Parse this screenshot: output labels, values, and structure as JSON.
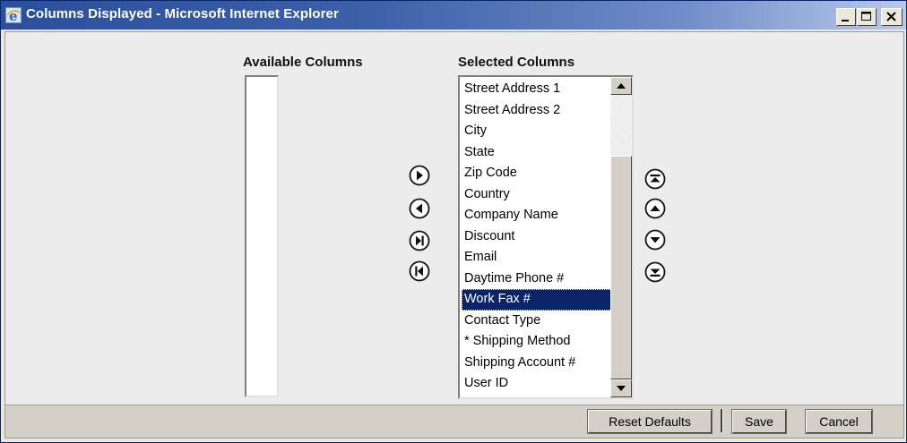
{
  "window": {
    "title": "Columns Displayed - Microsoft Internet Explorer",
    "controls": [
      "minimize",
      "maximize",
      "close"
    ]
  },
  "available": {
    "heading": "Available Columns",
    "items": []
  },
  "selected": {
    "heading": "Selected Columns",
    "items": [
      "Street Address 1",
      "Street Address 2",
      "City",
      "State",
      "Zip Code",
      "Country",
      "Company Name",
      "Discount",
      "Email",
      "Daytime Phone #",
      "Work Fax #",
      "Contact Type",
      "* Shipping Method",
      "Shipping Account #",
      "User ID"
    ],
    "selected_item": "Work Fax #"
  },
  "transfer_buttons": [
    "move-right-icon",
    "move-left-icon",
    "move-all-right-icon",
    "move-all-left-icon"
  ],
  "order_buttons": [
    "move-top-icon",
    "move-up-icon",
    "move-down-icon",
    "move-bottom-icon"
  ],
  "footer": {
    "reset_label": "Reset Defaults",
    "save_label": "Save",
    "cancel_label": "Cancel"
  },
  "colors": {
    "selection": "#0a246a",
    "titlebar": "#2b4f9a"
  }
}
